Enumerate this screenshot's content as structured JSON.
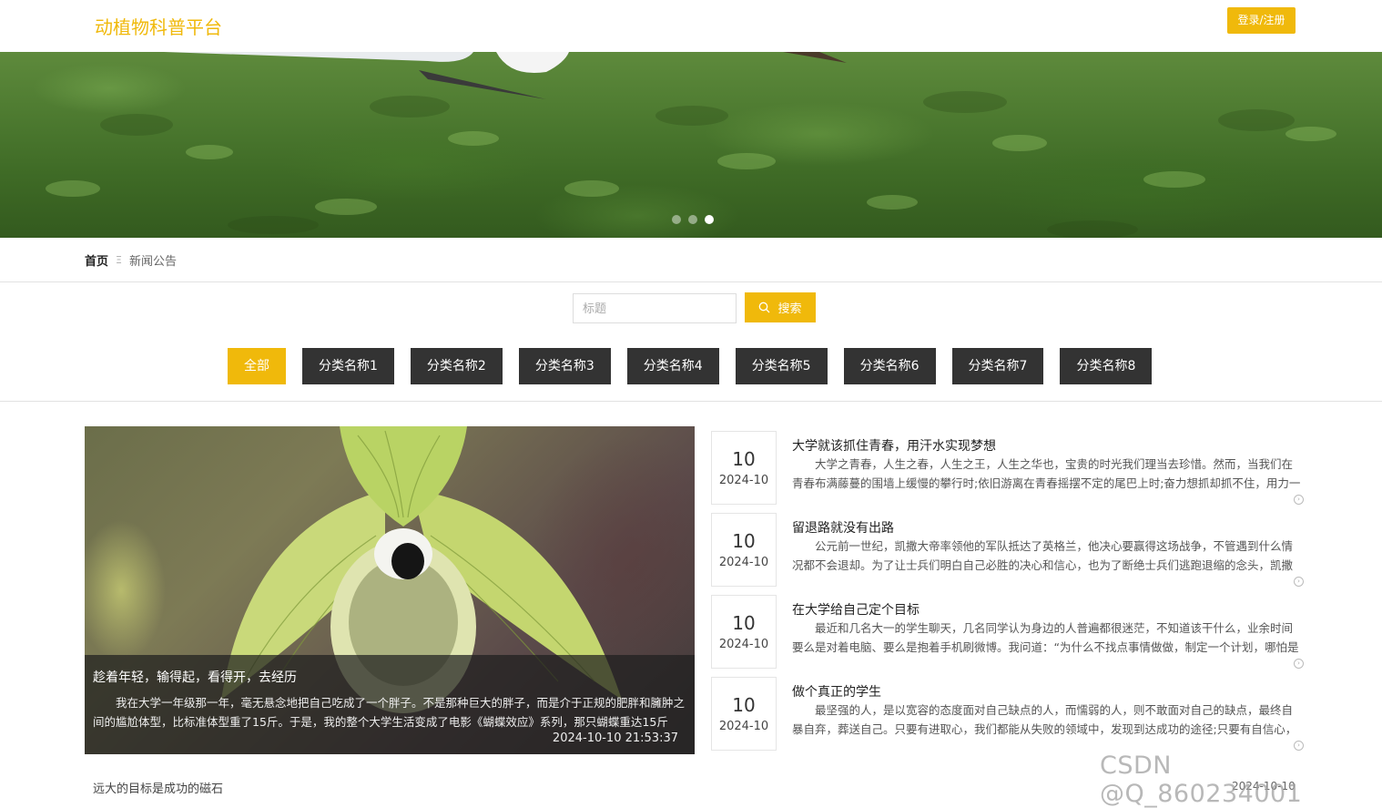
{
  "header": {
    "site_title": "动植物科普平台",
    "login_label": "登录/注册"
  },
  "banner": {
    "dots": [
      {
        "active": false
      },
      {
        "active": false
      },
      {
        "active": true
      }
    ]
  },
  "breadcrumb": {
    "home": "首页",
    "separator": "Ξ",
    "current": "新闻公告"
  },
  "search": {
    "placeholder": "标题",
    "button_label": "搜索"
  },
  "categories": {
    "all": "全部",
    "items": [
      "分类名称1",
      "分类名称2",
      "分类名称3",
      "分类名称4",
      "分类名称5",
      "分类名称6",
      "分类名称7",
      "分类名称8"
    ]
  },
  "feature": {
    "title": "趁着年轻，输得起，看得开，去经历",
    "desc": "我在大学一年级那一年，毫无悬念地把自己吃成了一个胖子。不是那种巨大的胖子，而是介于正规的肥胖和臃肿之间的尴尬体型，比标准体型重了15斤。于是，我的整个大学生活变成了电影《蝴蝶效应》系列，那只蝴蝶重达15斤",
    "date": "2024-10-10 21:53:37"
  },
  "news": [
    {
      "day": "10",
      "ym": "2024-10",
      "title": "大学就该抓住青春，用汗水实现梦想",
      "desc": "大学之青春，人生之春，人生之王，人生之华也，宝贵的时光我们理当去珍惜。然而，当我们在青春布满藤蔓的围墙上缓慢的攀行时;依旧游离在青春摇摆不定的尾巴上时;奋力想抓却抓不住，用力一"
    },
    {
      "day": "10",
      "ym": "2024-10",
      "title": "留退路就没有出路",
      "desc": "公元前一世纪，凯撒大帝率领他的军队抵达了英格兰，他决心要赢得这场战争，不管遇到什么情况都不会退却。为了让士兵们明白自己必胜的决心和信心，也为了断绝士兵们逃跑退缩的念头，凯撒"
    },
    {
      "day": "10",
      "ym": "2024-10",
      "title": "在大学给自己定个目标",
      "desc": "最近和几名大一的学生聊天，几名同学认为身边的人普遍都很迷茫，不知道该干什么，业余时间要么是对着电脑、要么是抱着手机刷微博。我问道：“为什么不找点事情做做，制定一个计划，哪怕是"
    },
    {
      "day": "10",
      "ym": "2024-10",
      "title": "做个真正的学生",
      "desc": "最坚强的人，是以宽容的态度面对自己缺点的人，而懦弱的人，则不敢面对自己的缺点，最终自暴自弃，葬送自己。只要有进取心，我们都能从失败的领域中，发现到达成功的途径;只要有自信心，"
    }
  ],
  "bottom": {
    "title": "远大的目标是成功的磁石",
    "date": "2024-10-10"
  },
  "watermark": "CSDN @Q_860234001",
  "colors": {
    "accent": "#f0b90b",
    "category_bg": "#333333"
  }
}
